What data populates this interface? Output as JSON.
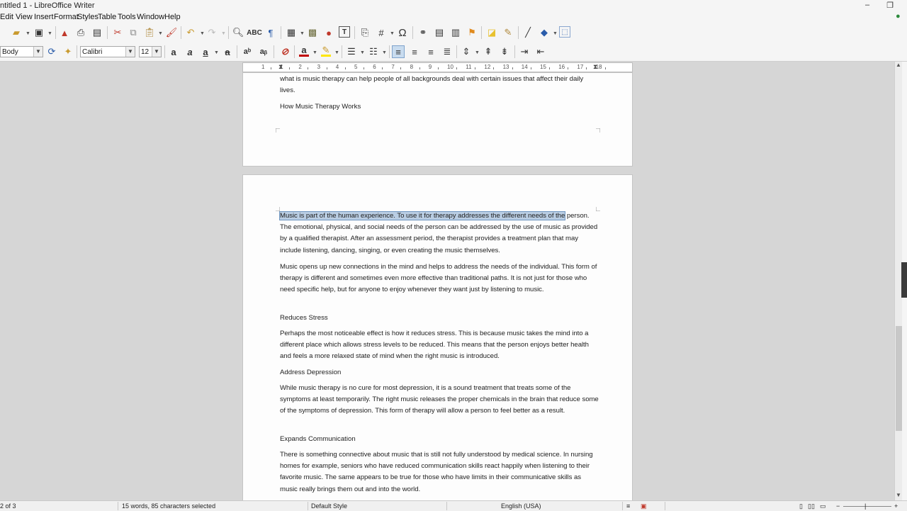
{
  "window": {
    "title": "ntitled 1 - LibreOffice Writer"
  },
  "menu": [
    "Edit",
    "View",
    "Insert",
    "Format",
    "Styles",
    "Table",
    "Tools",
    "Window",
    "Help"
  ],
  "formatting": {
    "paragraph_style": "Body",
    "font_name": "Calibri",
    "font_size": "12"
  },
  "document": {
    "page1_tail": [
      {
        "type": "p",
        "text": "what is music therapy can help people of all backgrounds deal with certain issues that affect their daily lives."
      },
      {
        "type": "h",
        "text": "How Music Therapy Works"
      }
    ],
    "page2": {
      "selected_text": "Music is part of the human experience. To use it for therapy addresses the different needs of the",
      "first_para_rest": "person. The emotional, physical, and social needs of the person can be addressed by the use of music as provided by a qualified therapist. After an assessment period, the therapist provides a treatment plan that may include listening, dancing, singing, or even creating the music themselves.",
      "para2": "Music opens up new connections in the mind and helps to address the needs of the individual. This form of therapy is different and sometimes even more effective than traditional paths. It is not just for those who need specific help, but for anyone to enjoy whenever they want just by listening to music.",
      "h1": "Reduces Stress",
      "para3": "Perhaps the most noticeable effect is how it reduces stress. This is because music takes the mind into a different place which allows stress levels to be reduced. This means that the person enjoys better health and feels a more relaxed state of mind when the right music is introduced.",
      "h2": "Address Depression",
      "para4": "While music therapy is no cure for most depression, it is a sound treatment that treats some of the symptoms at least temporarily. The right music releases the proper chemicals in the brain that reduce some of the symptoms of depression. This form of therapy will allow a person to feel better as a result.",
      "h3": "Expands Communication",
      "para5": "There is something connective about music that is still not fully understood by medical science. In nursing homes for example, seniors who have reduced communication skills react happily when listening to their favorite music. The same appears to be true for those who have limits in their communicative skills as music really brings them out and into the world."
    }
  },
  "ruler_numbers": [
    "1",
    "1",
    "2",
    "3",
    "4",
    "5",
    "6",
    "7",
    "8",
    "9",
    "10",
    "11",
    "12",
    "13",
    "14",
    "15",
    "16",
    "17",
    "18"
  ],
  "status": {
    "page": "2 of 3",
    "words": "15 words, 85 characters selected",
    "page_style": "Default Style",
    "language": "English (USA)"
  },
  "icons": {
    "toolbar1": [
      "open-icon",
      "save-icon",
      "export-pdf-icon",
      "print-icon",
      "print-preview-icon",
      "cut-icon",
      "copy-icon",
      "paste-icon",
      "clone-formatting-icon",
      "undo-icon",
      "redo-icon",
      "find-replace-icon",
      "spelling-icon",
      "formatting-marks-icon",
      "insert-table-icon",
      "insert-image-icon",
      "insert-chart-icon",
      "insert-textbox-icon",
      "page-break-icon",
      "field-icon",
      "special-character-icon",
      "hyperlink-icon",
      "footnote-icon",
      "endnote-icon",
      "bookmark-icon",
      "comment-icon",
      "track-changes-icon",
      "line-icon",
      "shapes-icon",
      "basic-shapes-icon"
    ],
    "toolbar2": [
      "update-style-icon",
      "new-style-icon",
      "bold-icon",
      "italic-icon",
      "underline-icon",
      "strikethrough-icon",
      "superscript-icon",
      "subscript-icon",
      "clear-formatting-icon",
      "font-color-icon",
      "highlight-icon",
      "unordered-list-icon",
      "ordered-list-icon",
      "align-left-icon",
      "align-center-icon",
      "align-right-icon",
      "justify-icon",
      "line-spacing-icon",
      "para-spacing-increase-icon",
      "para-spacing-decrease-icon",
      "indent-increase-icon",
      "indent-decrease-icon"
    ]
  },
  "colors": {
    "selection": "#b9cde3",
    "font_color": "#c00000",
    "highlight": "#ffe600"
  }
}
